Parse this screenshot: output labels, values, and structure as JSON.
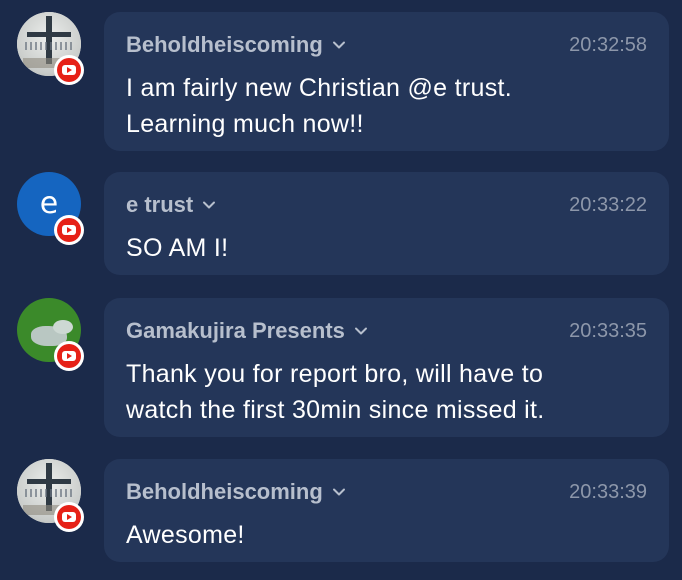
{
  "messages": [
    {
      "author": "Beholdheiscoming",
      "time": "20:32:58",
      "lines": [
        "I am fairly new Christian @e trust.",
        "Learning much now!!"
      ],
      "avatar": "cross-photo",
      "platform_icon": "youtube-icon"
    },
    {
      "author": "e trust",
      "time": "20:33:22",
      "lines": [
        "SO AM I!"
      ],
      "avatar_letter": "e",
      "avatar_color": "#1565c0",
      "platform_icon": "youtube-icon"
    },
    {
      "author": "Gamakujira Presents",
      "time": "20:33:35",
      "lines": [
        "Thank you for report bro, will have to",
        "watch the first 30min since missed it."
      ],
      "avatar": "green-logo",
      "platform_icon": "youtube-icon"
    },
    {
      "author": "Beholdheiscoming",
      "time": "20:33:39",
      "lines": [
        "Awesome!"
      ],
      "avatar": "cross-photo",
      "platform_icon": "youtube-icon"
    }
  ],
  "colors": {
    "background": "#1b2a4a",
    "bubble": "#243659",
    "author": "#b7bfcd",
    "timestamp": "#8d97aa",
    "youtube_red": "#e62117"
  }
}
